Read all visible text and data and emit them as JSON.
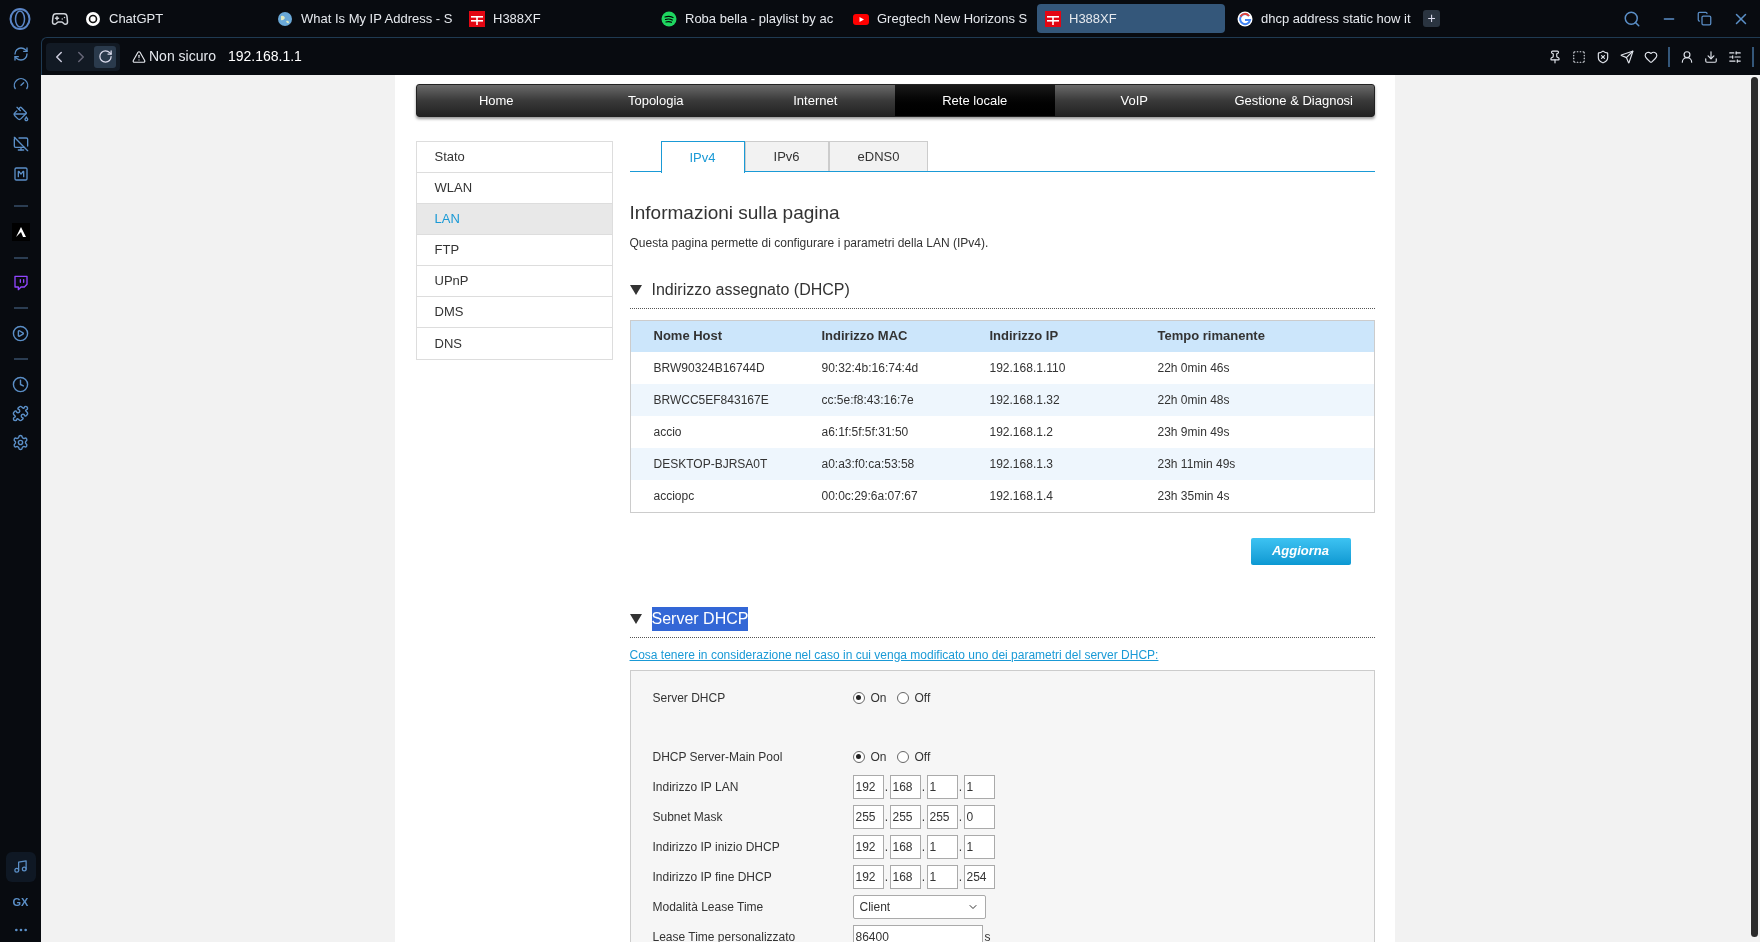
{
  "browser": {
    "tabs": [
      {
        "title": "ChatGPT",
        "selected": false
      },
      {
        "title": "What Is My IP Address - S",
        "selected": false
      },
      {
        "title": "H388XF",
        "selected": false
      },
      {
        "title": "Roba bella - playlist by ac",
        "selected": false
      },
      {
        "title": "Gregtech New Horizons S",
        "selected": false
      },
      {
        "title": "H388XF",
        "selected": true
      },
      {
        "title": "dhcp address static how it",
        "selected": false
      }
    ],
    "new_tab": "+",
    "security": "Non sicuro",
    "url": "192.168.1.1"
  },
  "sidebar": {
    "bottom_label": "GX"
  },
  "nav": [
    {
      "label": "Home",
      "selected": false
    },
    {
      "label": "Topologia",
      "selected": false
    },
    {
      "label": "Internet",
      "selected": false
    },
    {
      "label": "Rete locale",
      "selected": true
    },
    {
      "label": "VoIP",
      "selected": false
    },
    {
      "label": "Gestione & Diagnosi",
      "selected": false
    }
  ],
  "side_menu": [
    {
      "label": "Stato",
      "selected": false
    },
    {
      "label": "WLAN",
      "selected": false
    },
    {
      "label": "LAN",
      "selected": true
    },
    {
      "label": "FTP",
      "selected": false
    },
    {
      "label": "UPnP",
      "selected": false
    },
    {
      "label": "DMS",
      "selected": false
    },
    {
      "label": "DNS",
      "selected": false
    }
  ],
  "sub_tabs": [
    {
      "label": "IPv4",
      "selected": true
    },
    {
      "label": "IPv6",
      "selected": false
    },
    {
      "label": "eDNS0",
      "selected": false
    }
  ],
  "info": {
    "title": "Informazioni sulla pagina",
    "text": "Questa pagina permette di configurare i parametri della LAN (IPv4)."
  },
  "dhcp_leases": {
    "title": "Indirizzo assegnato (DHCP)",
    "expanded": true,
    "table": {
      "columns": [
        "Nome Host",
        "Indirizzo MAC",
        "Indirizzo IP",
        "Tempo rimanente"
      ],
      "rows": [
        [
          "BRW90324B16744D",
          "90:32:4b:16:74:4d",
          "192.168.1.110",
          "22h 0min 46s"
        ],
        [
          "BRWCC5EF843167E",
          "cc:5e:f8:43:16:7e",
          "192.168.1.32",
          "22h 0min 48s"
        ],
        [
          "accio",
          "a6:1f:5f:5f:31:50",
          "192.168.1.2",
          "23h 9min 49s"
        ],
        [
          "DESKTOP-BJRSA0T",
          "a0:a3:f0:ca:53:58",
          "192.168.1.3",
          "23h 11min 49s"
        ],
        [
          "acciopc",
          "00:0c:29:6a:07:67",
          "192.168.1.4",
          "23h 35min 4s"
        ]
      ]
    },
    "button": "Aggiorna"
  },
  "dhcp_server": {
    "title": "Server DHCP",
    "expanded": true,
    "highlighted": true,
    "link": "Cosa tenere in considerazione nel caso in cui venga modificato uno dei parametri del server DHCP:",
    "fields": [
      {
        "kind": "radio",
        "label": "Server DHCP",
        "options": [
          {
            "label": "On",
            "selected": true
          },
          {
            "label": "Off",
            "selected": false
          }
        ]
      },
      {
        "kind": "radio",
        "label": "DHCP Server-Main Pool",
        "options": [
          {
            "label": "On",
            "selected": true
          },
          {
            "label": "Off",
            "selected": false
          }
        ]
      },
      {
        "kind": "ip",
        "label": "Indirizzo IP LAN",
        "octets": [
          "192",
          "168",
          "1",
          "1"
        ],
        "separators": [
          ".",
          ".",
          "."
        ]
      },
      {
        "kind": "ip",
        "label": "Subnet Mask",
        "octets": [
          "255",
          "255",
          "255",
          "0"
        ],
        "separators": [
          ".",
          ".",
          "."
        ]
      },
      {
        "kind": "ip",
        "label": "Indirizzo IP inizio DHCP",
        "octets": [
          "192",
          "168",
          "1",
          "1"
        ],
        "separators": [
          ".",
          ".",
          "."
        ]
      },
      {
        "kind": "ip",
        "label": "Indirizzo IP fine DHCP",
        "octets": [
          "192",
          "168",
          "1",
          "254"
        ],
        "separators": [
          ".",
          ".",
          "."
        ]
      },
      {
        "kind": "select",
        "label": "Modalità Lease Time",
        "value": "Client"
      },
      {
        "kind": "number",
        "label": "Lease Time personalizzato",
        "value": "86400",
        "unit": "s"
      }
    ]
  }
}
